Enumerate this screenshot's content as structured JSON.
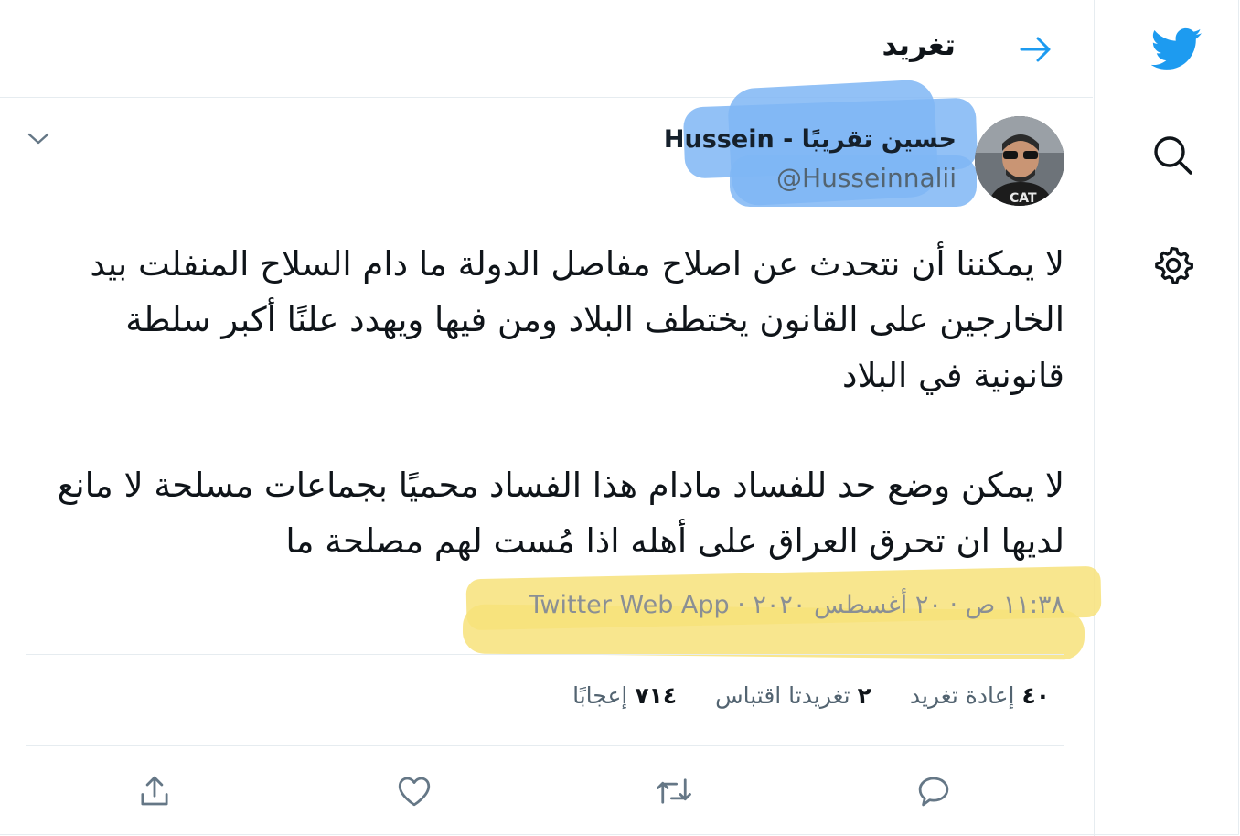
{
  "header": {
    "title": "تغريد",
    "back_icon": "arrow-right-icon"
  },
  "nav": {
    "logo_icon": "twitter-bird-icon",
    "search_icon": "search-icon",
    "settings_icon": "gear-icon",
    "brand_color": "#1d9bf0"
  },
  "tweet": {
    "display_name": "حسين تقريبًا - Hussein",
    "handle": "@Husseinnalii",
    "paragraph_1": "لا يمكننا أن نتحدث عن اصلاح مفاصل الدولة ما دام السلاح المنفلت بيد الخارجين على القانون يختطف البلاد ومن فيها ويهدد علنًا أكبر سلطة قانونية في البلاد",
    "paragraph_2": "لا يمكن وضع حد للفساد مادام هذا الفساد محميًا بجماعات مسلحة لا مانع لديها ان تحرق العراق على أهله اذا مُست لهم مصلحة ما",
    "meta": "١١:٣٨ ص · ٢٠ أغسطس ٢٠٢٠ · Twitter Web App"
  },
  "stats": {
    "retweets_count": "٤٠",
    "retweets_label": "إعادة تغريد",
    "quotes_count": "٢",
    "quotes_label": "تغريدتا اقتباس",
    "likes_count": "٧١٤",
    "likes_label": "إعجابًا"
  },
  "actions": {
    "reply_icon": "reply-icon",
    "retweet_icon": "retweet-icon",
    "like_icon": "heart-icon",
    "share_icon": "share-icon"
  },
  "highlights": {
    "name_color": "#7fb6f5",
    "meta_color": "#f7e27a"
  }
}
